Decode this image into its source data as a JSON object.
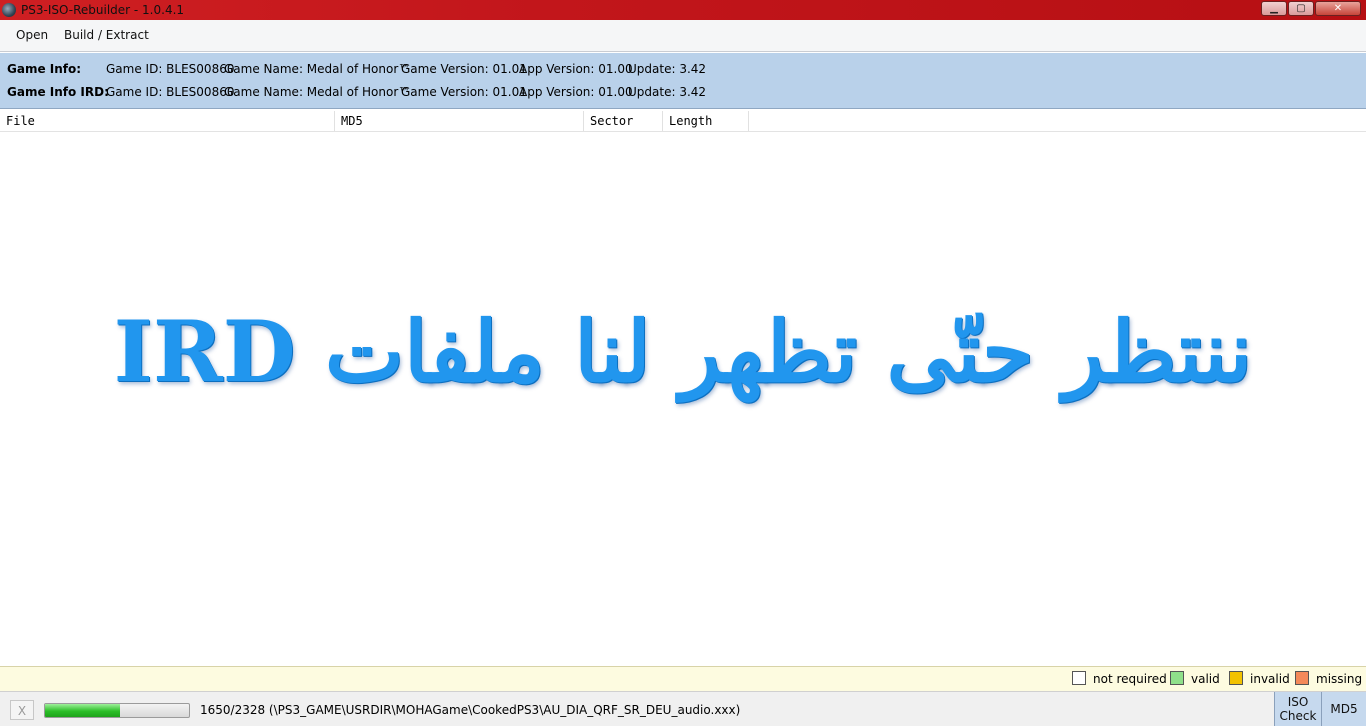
{
  "window": {
    "title": "PS3-ISO-Rebuilder - 1.0.4.1",
    "minimize_glyph": "▁",
    "maximize_glyph": "▢",
    "close_glyph": "✕"
  },
  "menu": {
    "open": "Open",
    "build_extract": "Build / Extract"
  },
  "game_info": {
    "label": "Game Info:",
    "game_id": "Game ID: BLES00860",
    "game_name": "Game Name: Medal of Honor™",
    "game_version": "Game Version: 01.01",
    "app_version": "App Version: 01.00",
    "update": "Update: 3.42"
  },
  "game_info_ird": {
    "label": "Game Info IRD:",
    "game_id": "Game ID: BLES00860",
    "game_name": "Game Name: Medal of Honor™",
    "game_version": "Game Version: 01.01",
    "app_version": "App Version: 01.00",
    "update": "Update: 3.42"
  },
  "columns": [
    "File",
    "MD5",
    "Sector",
    "Length"
  ],
  "overlay_text": "ننتظر حتّى تظهر لنا ملفات IRD",
  "legend": [
    {
      "label": "not required",
      "color": "#ffffff"
    },
    {
      "label": "valid",
      "color": "#8fe08a"
    },
    {
      "label": "invalid",
      "color": "#f2c200"
    },
    {
      "label": "missing",
      "color": "#f4895a"
    }
  ],
  "status": {
    "cancel_label": "X",
    "progress_fraction": 0.52,
    "text": "1650/2328 (\\PS3_GAME\\USRDIR\\MOHAGame\\CookedPS3\\AU_DIA_QRF_SR_DEU_audio.xxx)",
    "iso_check_label_line1": "ISO",
    "iso_check_label_line2": "Check",
    "md5_label": "MD5"
  },
  "colors": {
    "titlebar": "#c2161b",
    "info_panel": "#b9d1ea",
    "legend_bar": "#fdfbe0",
    "overlay_text": "#2196ee"
  }
}
